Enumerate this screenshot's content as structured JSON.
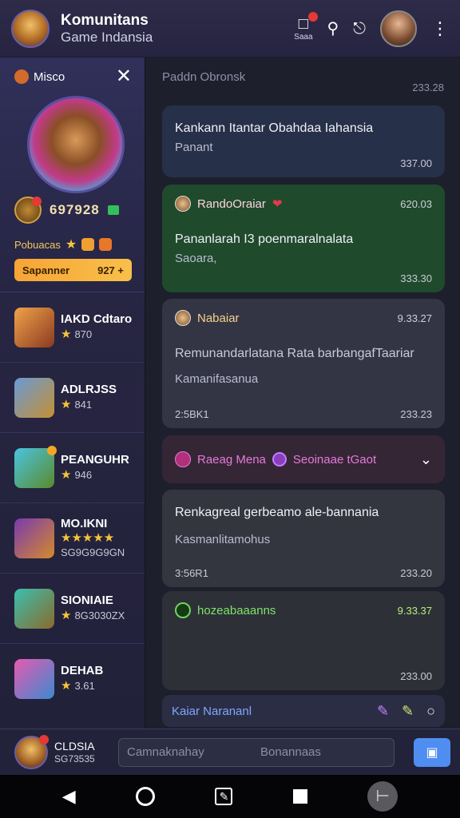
{
  "header": {
    "title_line1": "Komunitans",
    "title_line2": "Game Indansia",
    "notif_label": "Saaa",
    "icons": [
      "notification-icon",
      "search-icon",
      "bell-icon",
      "user-avatar",
      "kebab-menu-icon"
    ]
  },
  "hero": {
    "name": "Misco",
    "score": "697928",
    "row_label": "Pobuacas",
    "bar_label": "Sapanner",
    "bar_value": "927 +"
  },
  "games": [
    {
      "name": "IAKD Cdtaro",
      "rating": "870"
    },
    {
      "name": "ADLRJSS",
      "rating": "841"
    },
    {
      "name": "PEANGUHR",
      "rating": "946"
    },
    {
      "name": "MO.IKNI",
      "rating": "SG9G9G9GN"
    },
    {
      "name": "SIONIAIE",
      "rating": "8G3030ZX"
    },
    {
      "name": "DEHAB",
      "rating": "3.61"
    }
  ],
  "chat": {
    "header_label": "Paddn Obronsk",
    "header_time": "233.28",
    "messages": [
      {
        "body": "Kankann Itantar Obahdaa Iahansia",
        "sub": "Panant",
        "time": "337.00"
      },
      {
        "sender": "RandoOraiar",
        "time": "620.03",
        "body": "Pananlarah I3 poenmaralnalata",
        "sub": "Saoara,",
        "foot_time": "333.30"
      },
      {
        "sender": "Nabaiar",
        "time": "9.33.27",
        "body": "Remunandarlatana Rata barbangafTaariar",
        "sub": "Kamanifasanua",
        "foot_left": "2:5BK1",
        "foot_time": "233.23"
      },
      {
        "sender": "Raeag Mena",
        "second": "Seoinaae tGaot"
      },
      {
        "body": "Renkagreal gerbeamo ale-bannania",
        "sub": "Kasmanlitamohus",
        "foot_left": "3:56R1",
        "foot_time": "233.20"
      },
      {
        "sender": "hozeabaaanns",
        "time": "9.33.37",
        "foot_time": "233.00"
      }
    ],
    "reply_label": "Kaiar Narananl"
  },
  "composer": {
    "me_name": "CLDSIA",
    "me_id": "SG73535",
    "placeholder": "Camnaknahay",
    "hint": "Bonannaas"
  }
}
